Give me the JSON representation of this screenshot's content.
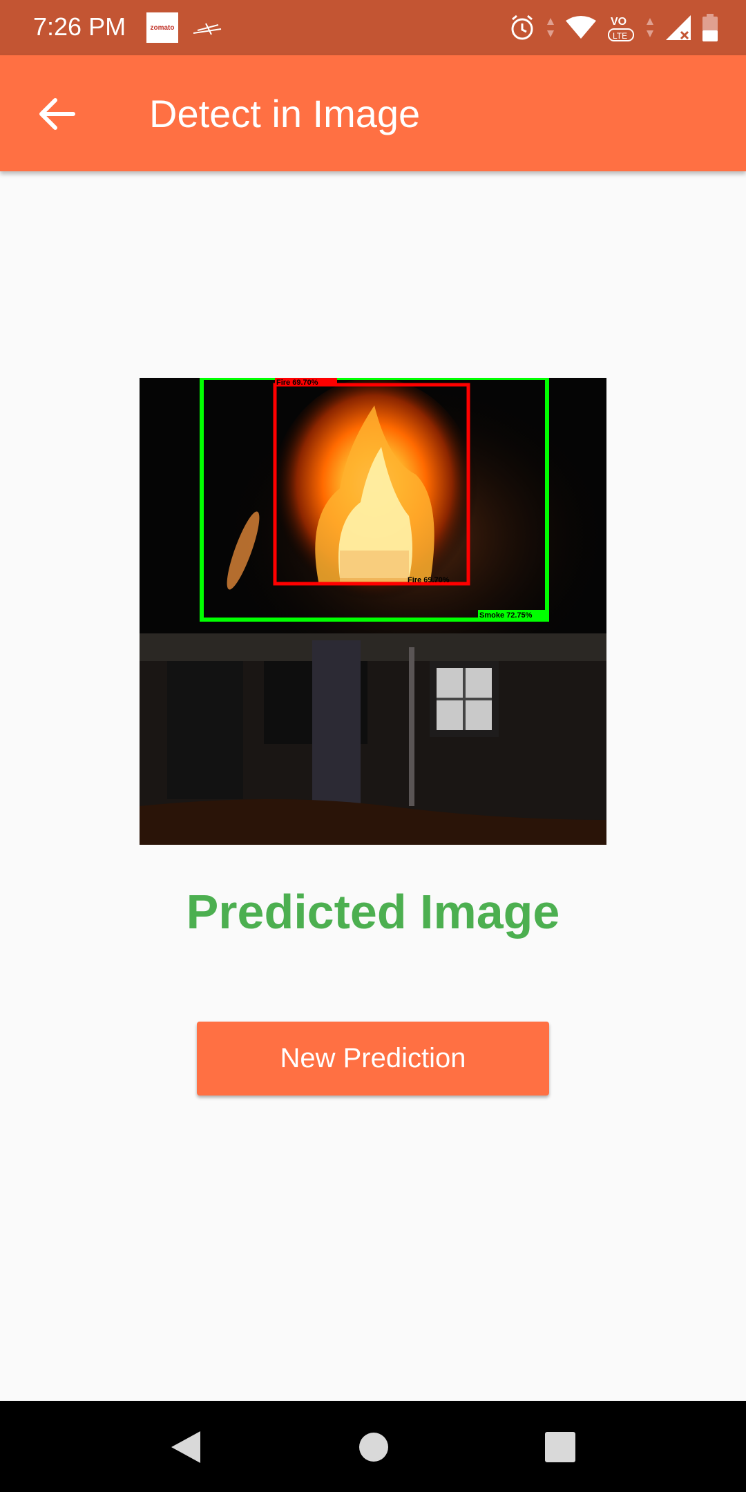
{
  "status_bar": {
    "time": "7:26 PM",
    "notification_icons": [
      "zomato-icon",
      "train-icon"
    ],
    "system_icons": [
      "alarm-icon",
      "wifi-icon",
      "volte-icon",
      "signal-icon",
      "battery-icon"
    ],
    "zomato_text": "zomato",
    "volte_text": "VoLTE"
  },
  "app_bar": {
    "title": "Detect in Image",
    "back_icon": "arrow-back-icon",
    "color": "#FF7043"
  },
  "prediction": {
    "label": "Predicted Image",
    "detections": [
      {
        "label": "Smoke 72.75%",
        "color": "#00FF00"
      },
      {
        "label": "Fire 69.70%",
        "color": "#FF0000"
      }
    ],
    "label_color": "#4CAF50"
  },
  "actions": {
    "new_prediction_label": "New Prediction"
  },
  "nav_bar": {
    "icons": [
      "nav-back-icon",
      "nav-home-icon",
      "nav-recents-icon"
    ]
  }
}
